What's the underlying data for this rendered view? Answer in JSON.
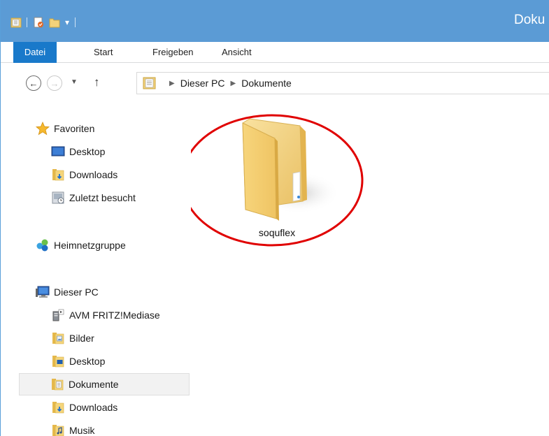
{
  "window": {
    "title": "Doku",
    "qat_dropdown": "▾"
  },
  "ribbon": {
    "tabs": [
      {
        "label": "Datei",
        "active": true
      },
      {
        "label": "Start"
      },
      {
        "label": "Freigeben"
      },
      {
        "label": "Ansicht"
      }
    ]
  },
  "navigation": {
    "back_icon": "←",
    "forward_icon": "→",
    "recent_icon": "▼",
    "up_icon": "↑",
    "breadcrumb": [
      "Dieser PC",
      "Dokumente"
    ],
    "breadcrumb_separator": "▶"
  },
  "navpane": {
    "items": [
      {
        "label": "Favoriten",
        "icon": "star-icon"
      },
      {
        "label": "Desktop",
        "icon": "desktop-icon"
      },
      {
        "label": "Downloads",
        "icon": "downloads-folder-icon"
      },
      {
        "label": "Zuletzt besucht",
        "icon": "recent-places-icon"
      },
      {
        "label": "Heimnetzgruppe",
        "icon": "homegroup-icon"
      },
      {
        "label": "Dieser PC",
        "icon": "computer-icon"
      },
      {
        "label": "AVM FRITZ!Mediase",
        "icon": "media-server-icon"
      },
      {
        "label": "Bilder",
        "icon": "pictures-folder-icon"
      },
      {
        "label": "Desktop",
        "icon": "desktop-folder-icon"
      },
      {
        "label": "Dokumente",
        "icon": "documents-folder-icon",
        "selected": true
      },
      {
        "label": "Downloads",
        "icon": "downloads-folder-icon"
      },
      {
        "label": "Musik",
        "icon": "music-folder-icon"
      }
    ]
  },
  "content": {
    "items": [
      {
        "label": "soquflex",
        "icon": "folder-icon",
        "highlighted": true
      }
    ]
  },
  "colors": {
    "titlebar": "#5b9bd5",
    "active_tab": "#1979ca",
    "highlight_ring": "#e00000",
    "folder": "#f5d57a"
  }
}
